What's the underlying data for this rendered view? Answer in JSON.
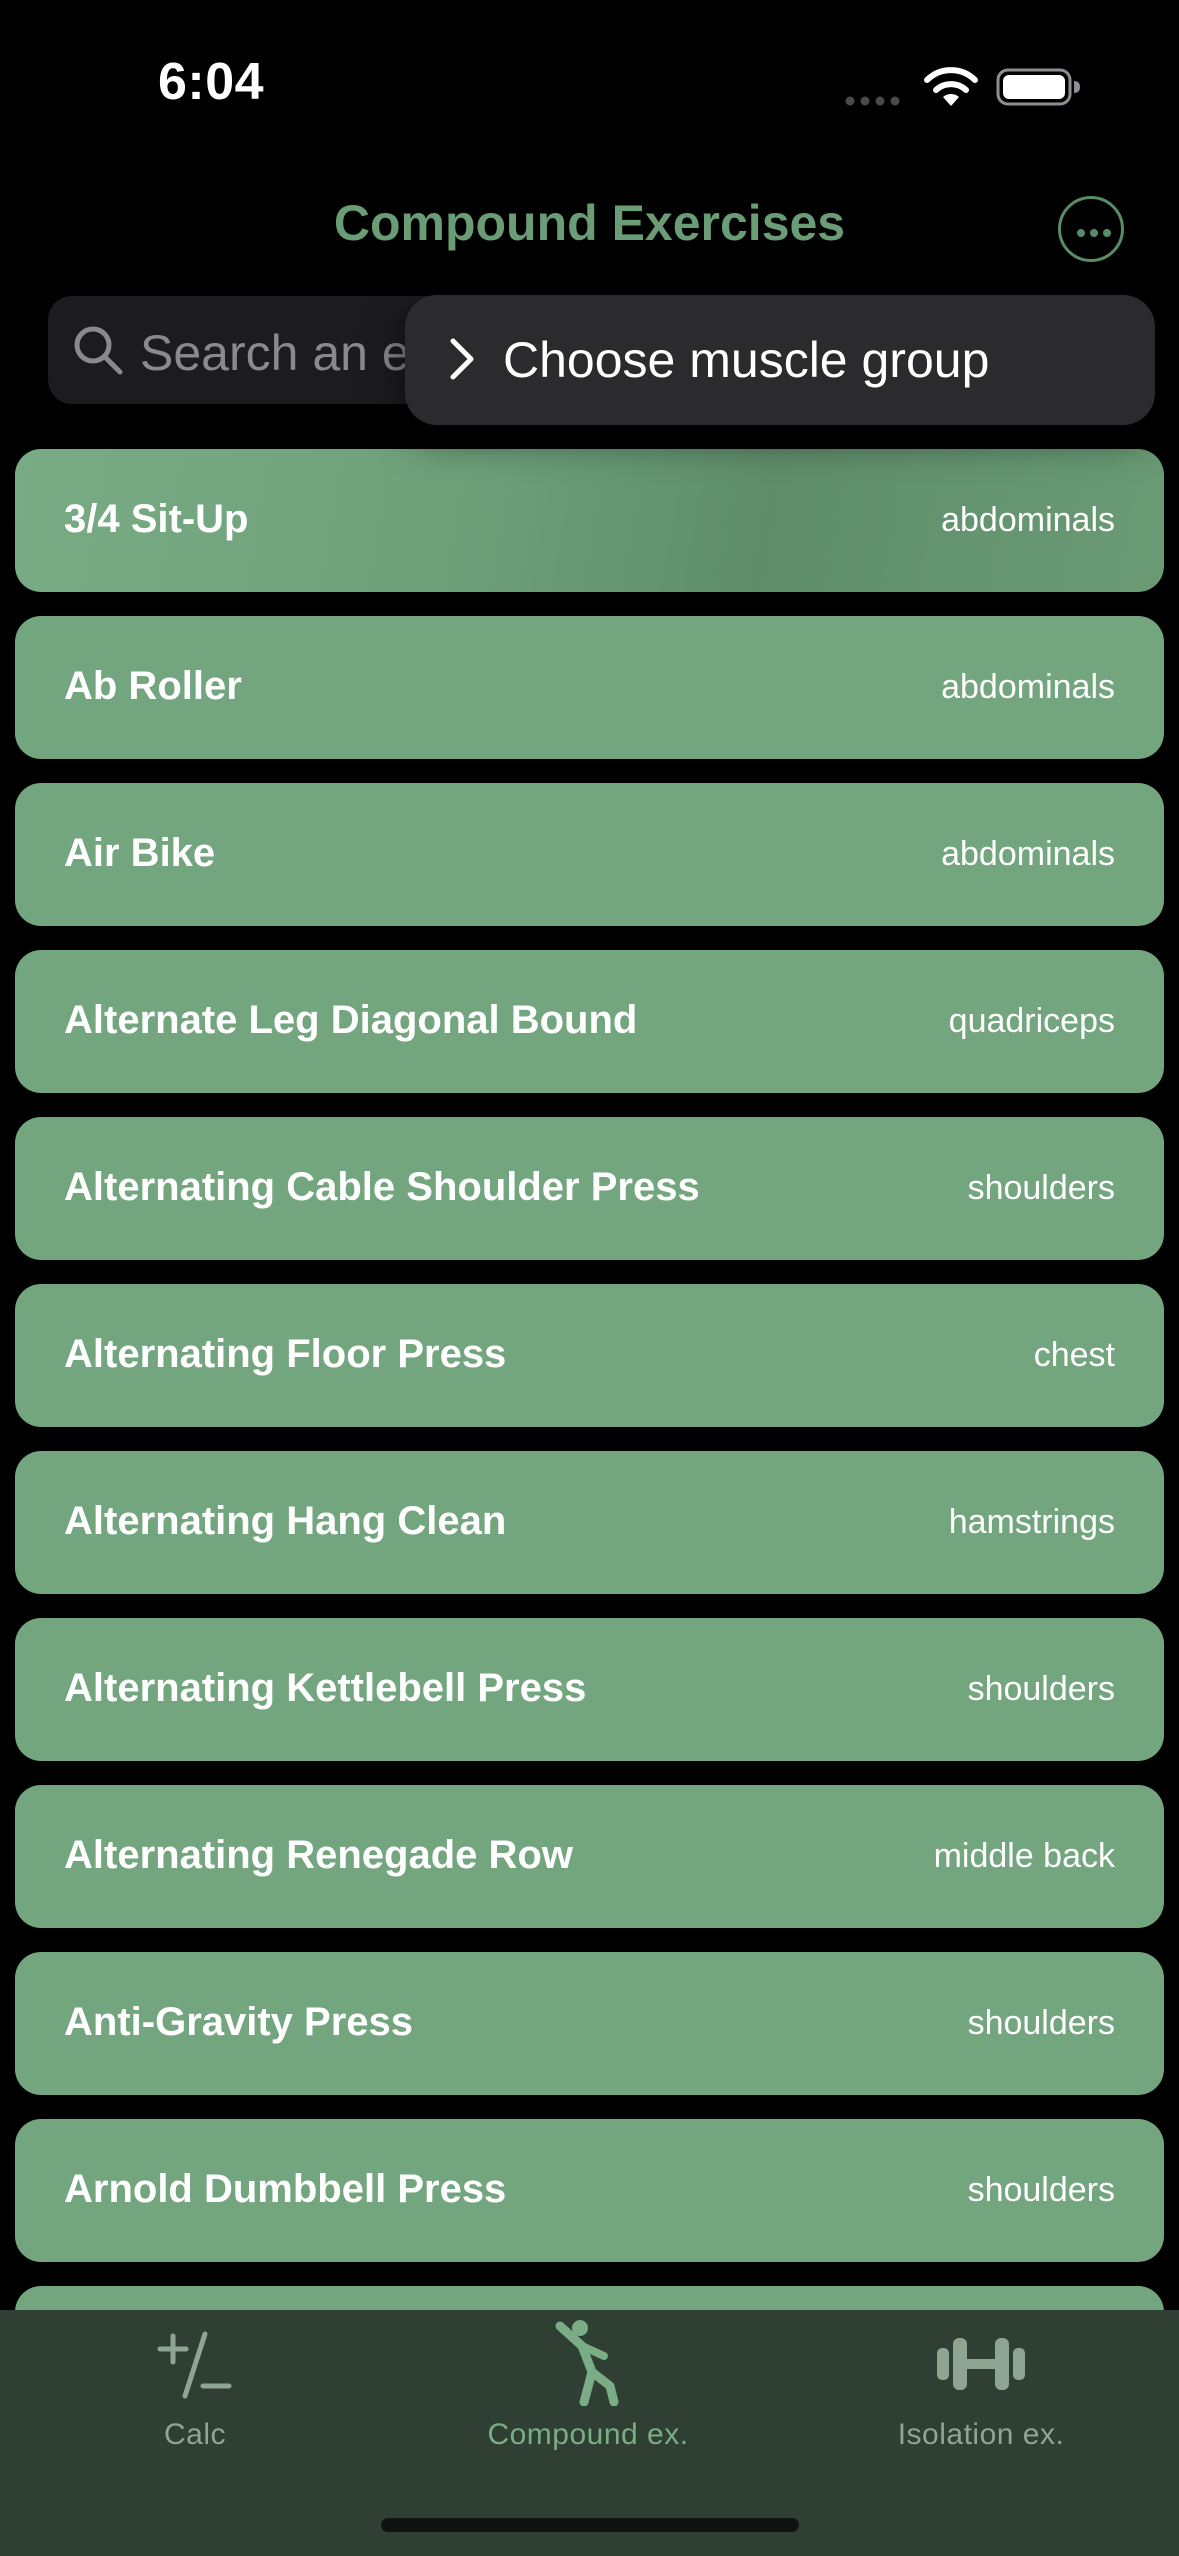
{
  "status_bar": {
    "time": "6:04"
  },
  "header": {
    "title": "Compound Exercises",
    "more_icon": "ellipsis-circle-icon"
  },
  "search": {
    "placeholder": "Search an exercise",
    "visible_text": "Search an e"
  },
  "muscle_menu": {
    "label": "Choose muscle group"
  },
  "exercises": [
    {
      "name": "3/4 Sit-Up",
      "muscle": "abdominals"
    },
    {
      "name": "Ab Roller",
      "muscle": "abdominals"
    },
    {
      "name": "Air Bike",
      "muscle": "abdominals"
    },
    {
      "name": "Alternate Leg Diagonal Bound",
      "muscle": "quadriceps"
    },
    {
      "name": "Alternating Cable Shoulder Press",
      "muscle": "shoulders"
    },
    {
      "name": "Alternating Floor Press",
      "muscle": "chest"
    },
    {
      "name": "Alternating Hang Clean",
      "muscle": "hamstrings"
    },
    {
      "name": "Alternating Kettlebell Press",
      "muscle": "shoulders"
    },
    {
      "name": "Alternating Renegade Row",
      "muscle": "middle back"
    },
    {
      "name": "Anti-Gravity Press",
      "muscle": "shoulders"
    },
    {
      "name": "Arnold Dumbbell Press",
      "muscle": "shoulders"
    }
  ],
  "tab_bar": {
    "tabs": [
      {
        "label": "Calc",
        "icon": "plus-slash-minus-icon",
        "active": false
      },
      {
        "label": "Compound ex.",
        "icon": "figure-stretch-icon",
        "active": true
      },
      {
        "label": "Isolation ex.",
        "icon": "dumbbell-icon",
        "active": false
      }
    ]
  },
  "colors": {
    "accent": "#6a9c76",
    "row_bg": "#73a57f",
    "tab_bar_bg": "#2f3f33",
    "tab_inactive": "#8fa593",
    "tab_active": "#7aac86"
  }
}
